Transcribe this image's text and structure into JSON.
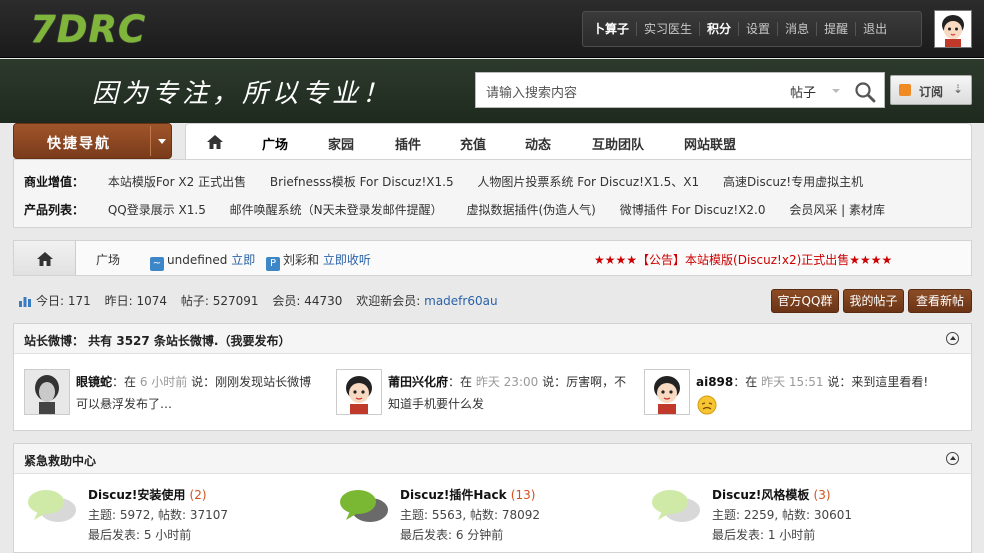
{
  "site": {
    "logo_text": "7DRC",
    "slogan": "因为专注，所以专业！"
  },
  "user_nav": {
    "username": "卜算子",
    "items": [
      "实习医生",
      "积分",
      "设置",
      "消息",
      "提醒",
      "退出"
    ]
  },
  "search": {
    "placeholder": "请输入搜索内容",
    "type": "帖子"
  },
  "rss": {
    "label": "订阅"
  },
  "quick_nav": {
    "label": "快捷导航"
  },
  "nav": {
    "items": [
      "广场",
      "家园",
      "插件",
      "充值",
      "动态",
      "互助团队",
      "网站联盟"
    ]
  },
  "promo": {
    "row1": {
      "heading": "商业增值：",
      "links": [
        "本站模版For X2 正式出售",
        "Briefnesss模板 For Discuz!X1.5",
        "人物图片投票系统 For Discuz!X1.5、X1",
        "高速Discuz!专用虚拟主机"
      ]
    },
    "row2": {
      "heading": "产品列表：",
      "links": [
        "QQ登录展示 X1.5",
        "邮件唤醒系统（N天未登录发邮件提醒）",
        "虚拟数据插件(伪造人气)",
        "微博插件 For Discuz!X2.0",
        "会员风采 | 素材库"
      ]
    }
  },
  "crumb": {
    "item": "广场",
    "user1_name": "undefined",
    "user1_action": "立即",
    "user2_name": "刘彩和",
    "user2_action": "立即收听",
    "announcement": "★★★★【公告】本站模版(Discuz!x2)正式出售★★★★"
  },
  "stats": {
    "today_label": "今日:",
    "today": "171",
    "yesterday_label": "昨日:",
    "yesterday": "1074",
    "posts_label": "帖子:",
    "posts": "527091",
    "members_label": "会员:",
    "members": "44730",
    "welcome_label": "欢迎新会员:",
    "new_member": "madefr60au"
  },
  "buttons": [
    "官方QQ群",
    "我的帖子",
    "查看新帖"
  ],
  "weibo_panel": {
    "title": "站长微博：  共有  3527 条站长微博.（我要发布）",
    "items": [
      {
        "name": "眼镜蛇",
        "prefix": "：在",
        "time": "6 小时前",
        "suffix": "说：刚刚发现站长微博",
        "line2": "可以悬浮发布了…"
      },
      {
        "name": "莆田兴化府",
        "prefix": "：在",
        "time": "昨天 23:00",
        "suffix": "说：厉害啊，不",
        "line2": "知道手机要什么发"
      },
      {
        "name": "ai898",
        "prefix": "：在",
        "time": "昨天 15:51",
        "suffix": "说：来到這里看看!",
        "line2": ""
      }
    ]
  },
  "help_panel": {
    "title": "紧急救助中心",
    "forums": [
      {
        "name": "Discuz!安装使用",
        "count": "(2)",
        "stats": "主题: 5972, 帖数: 37107",
        "last": "最后发表: 5 小时前"
      },
      {
        "name": "Discuz!插件Hack",
        "count": "(13)",
        "stats": "主题: 5563, 帖数: 78092",
        "last": "最后发表: 6 分钟前"
      },
      {
        "name": "Discuz!风格模板",
        "count": "(3)",
        "stats": "主题: 2259, 帖数: 30601",
        "last": "最后发表: 1 小时前"
      }
    ]
  }
}
